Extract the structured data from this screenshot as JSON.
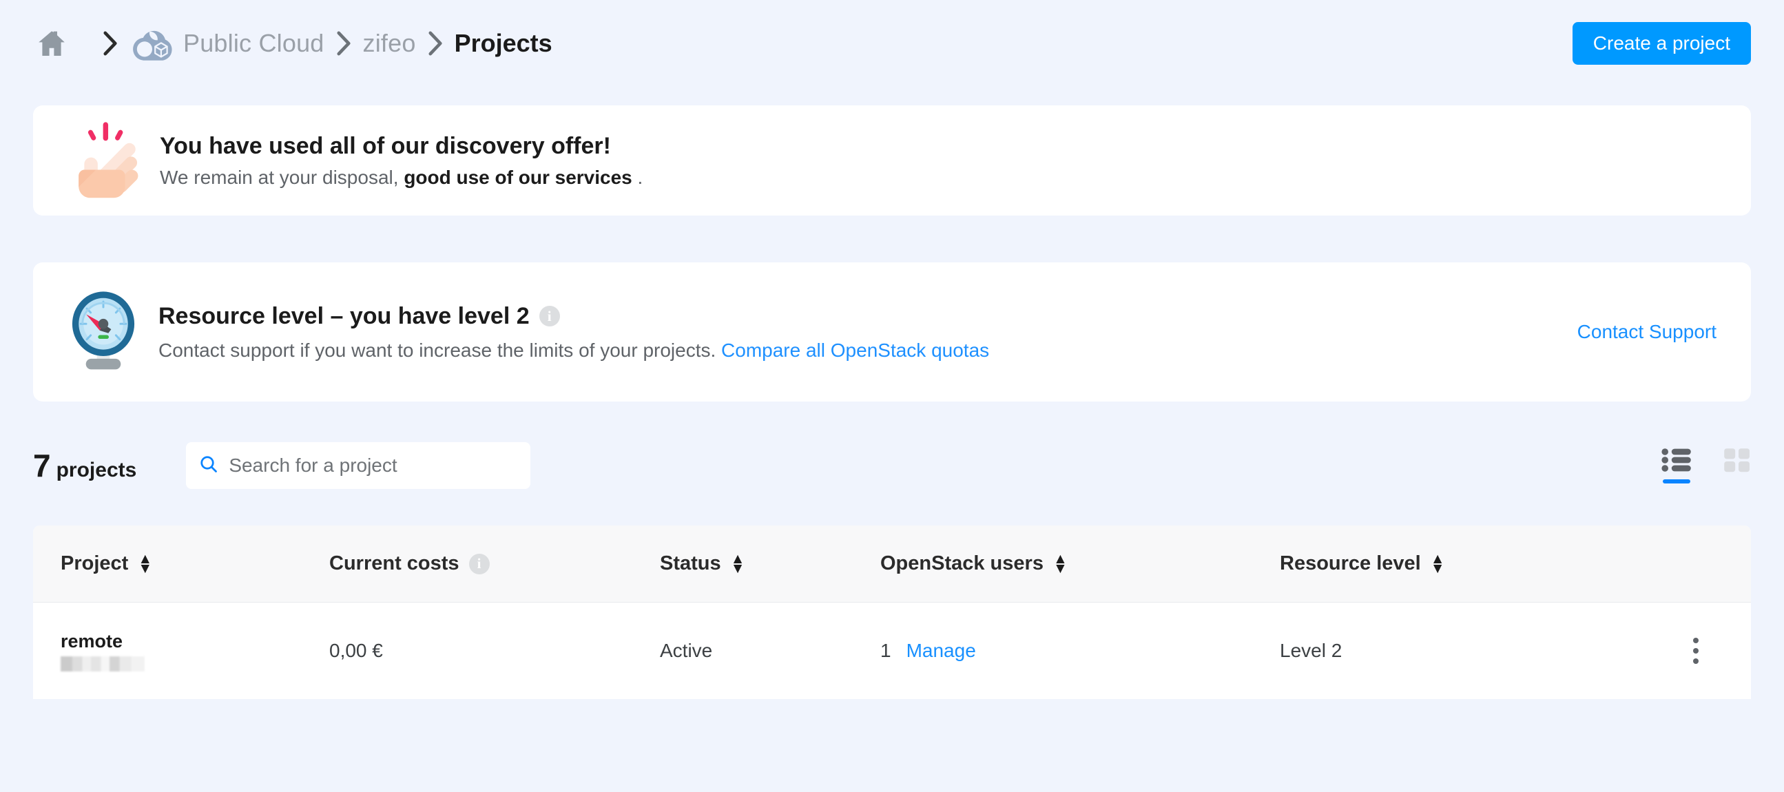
{
  "breadcrumb": {
    "home_icon": "home-icon",
    "separator": "chevron-right-icon",
    "cloud_icon": "public-cloud-icon",
    "items": [
      {
        "label": "Public Cloud",
        "current": false
      },
      {
        "label": "zifeo",
        "current": false
      },
      {
        "label": "Projects",
        "current": true
      }
    ]
  },
  "header": {
    "create_project_label": "Create a project"
  },
  "notice": {
    "icon": "pointing-hand-icon",
    "title": "You have used all of our discovery offer!",
    "sub_prefix": "We remain at your disposal, ",
    "sub_bold": "good use of our services",
    "sub_suffix": " ."
  },
  "resource_level": {
    "icon": "gauge-icon",
    "title": "Resource level – you have level 2",
    "info_icon": "info-icon",
    "info_glyph": "i",
    "description": "Contact support if you want to increase the limits of your projects.",
    "compare_link": "Compare all OpenStack quotas",
    "support_link": "Contact Support"
  },
  "toolbar": {
    "count": "7",
    "count_word": "projects",
    "search_placeholder": "Search for a project",
    "search_value": "",
    "search_icon": "search-icon",
    "view_list_icon": "list-view-icon",
    "view_grid_icon": "grid-view-icon",
    "active_view": "list"
  },
  "table": {
    "columns": [
      {
        "label": "Project",
        "sortable": true,
        "info": false
      },
      {
        "label": "Current costs",
        "sortable": false,
        "info": true
      },
      {
        "label": "Status",
        "sortable": true,
        "info": false
      },
      {
        "label": "OpenStack users",
        "sortable": true,
        "info": false
      },
      {
        "label": "Resource level",
        "sortable": true,
        "info": false
      }
    ],
    "rows": [
      {
        "project_name": "remote",
        "project_id_redacted": true,
        "current_costs": "0,00 €",
        "status": "Active",
        "users_count": "1",
        "users_action": "Manage",
        "resource_level": "Level 2",
        "actions_icon": "kebab-menu-icon"
      }
    ]
  },
  "colors": {
    "page_background": "#f0f4fd",
    "card_background": "#ffffff",
    "accent_blue": "#0099ff",
    "link_blue": "#1890ff",
    "text_primary": "#1b1b1b",
    "text_secondary": "#5f6368",
    "header_row": "#f8f8f9"
  }
}
